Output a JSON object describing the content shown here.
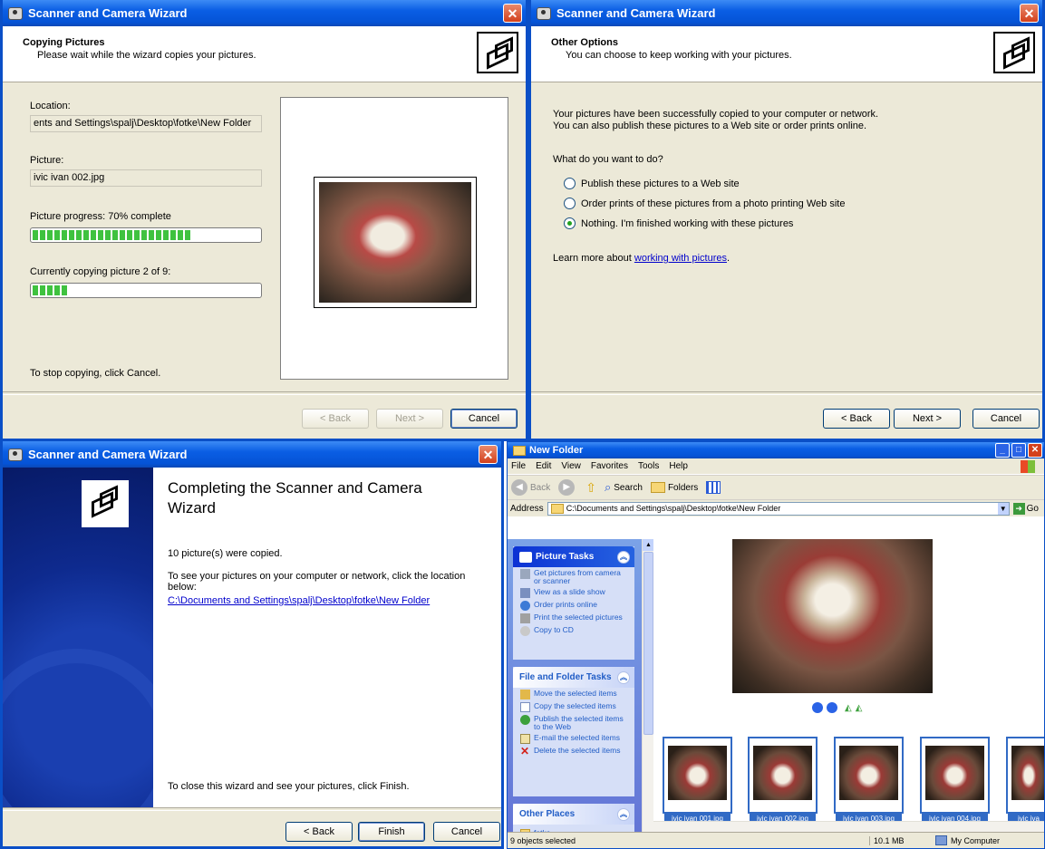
{
  "window_title": "Scanner and Camera Wizard",
  "copying": {
    "heading": "Copying Pictures",
    "subheading": "Please wait while the wizard copies your pictures.",
    "location_label": "Location:",
    "location_value": "ents and Settings\\spalj\\Desktop\\fotke\\New Folder",
    "picture_label": "Picture:",
    "picture_value": "ivic ivan 002.jpg",
    "progress_label": "Picture progress: 70% complete",
    "progress_fraction": 0.7,
    "copying_label": "Currently copying picture 2 of 9:",
    "copying_fraction": 0.15,
    "stop_text": "To stop copying, click Cancel.",
    "buttons": {
      "back": "< Back",
      "next": "Next >",
      "cancel": "Cancel"
    }
  },
  "options": {
    "heading": "Other Options",
    "subheading": "You can choose to keep working with your pictures.",
    "success_line1": "Your pictures have been successfully copied to your computer or network.",
    "success_line2": "You can also publish these pictures to a Web site or order prints online.",
    "question": "What do you want to do?",
    "choices": [
      {
        "label": "Publish these pictures to a Web site",
        "selected": false
      },
      {
        "label": "Order prints of these pictures from a photo printing Web site",
        "selected": false
      },
      {
        "label": "Nothing. I'm finished working with these pictures",
        "selected": true
      }
    ],
    "learn_prefix": "Learn more about ",
    "learn_link": "working with pictures",
    "learn_suffix": ".",
    "buttons": {
      "back": "< Back",
      "next": "Next >",
      "cancel": "Cancel"
    }
  },
  "completing": {
    "title": "Completing the Scanner and Camera Wizard",
    "copied": "10 picture(s) were copied.",
    "see_text": "To see your pictures on your computer or network, click the location below:",
    "location_link": "C:\\Documents and Settings\\spalj\\Desktop\\fotke\\New Folder",
    "close_text": "To close this wizard and see your pictures, click Finish.",
    "buttons": {
      "back": "< Back",
      "finish": "Finish",
      "cancel": "Cancel"
    }
  },
  "explorer": {
    "title": "New Folder",
    "menu": [
      "File",
      "Edit",
      "View",
      "Favorites",
      "Tools",
      "Help"
    ],
    "toolbar": {
      "back": "Back",
      "search": "Search",
      "folders": "Folders"
    },
    "address_label": "Address",
    "address_value": "C:\\Documents and Settings\\spalj\\Desktop\\fotke\\New Folder",
    "go_label": "Go",
    "picture_tasks": {
      "title": "Picture Tasks",
      "items": [
        "Get pictures from camera or scanner",
        "View as a slide show",
        "Order prints online",
        "Print the selected pictures",
        "Copy to CD"
      ]
    },
    "file_tasks": {
      "title": "File and Folder Tasks",
      "items": [
        "Move the selected items",
        "Copy the selected items",
        "Publish the selected items to the Web",
        "E-mail the selected items",
        "Delete the selected items"
      ]
    },
    "other_places": {
      "title": "Other Places",
      "items": [
        "fotke"
      ]
    },
    "thumbnails": [
      "ivic ivan 001.jpg",
      "ivic ivan 002.jpg",
      "ivic ivan 003.jpg",
      "ivic ivan 004.jpg",
      "ivic iva"
    ],
    "status_selected": "9 objects selected",
    "status_size": "10.1 MB",
    "status_location": "My Computer"
  }
}
